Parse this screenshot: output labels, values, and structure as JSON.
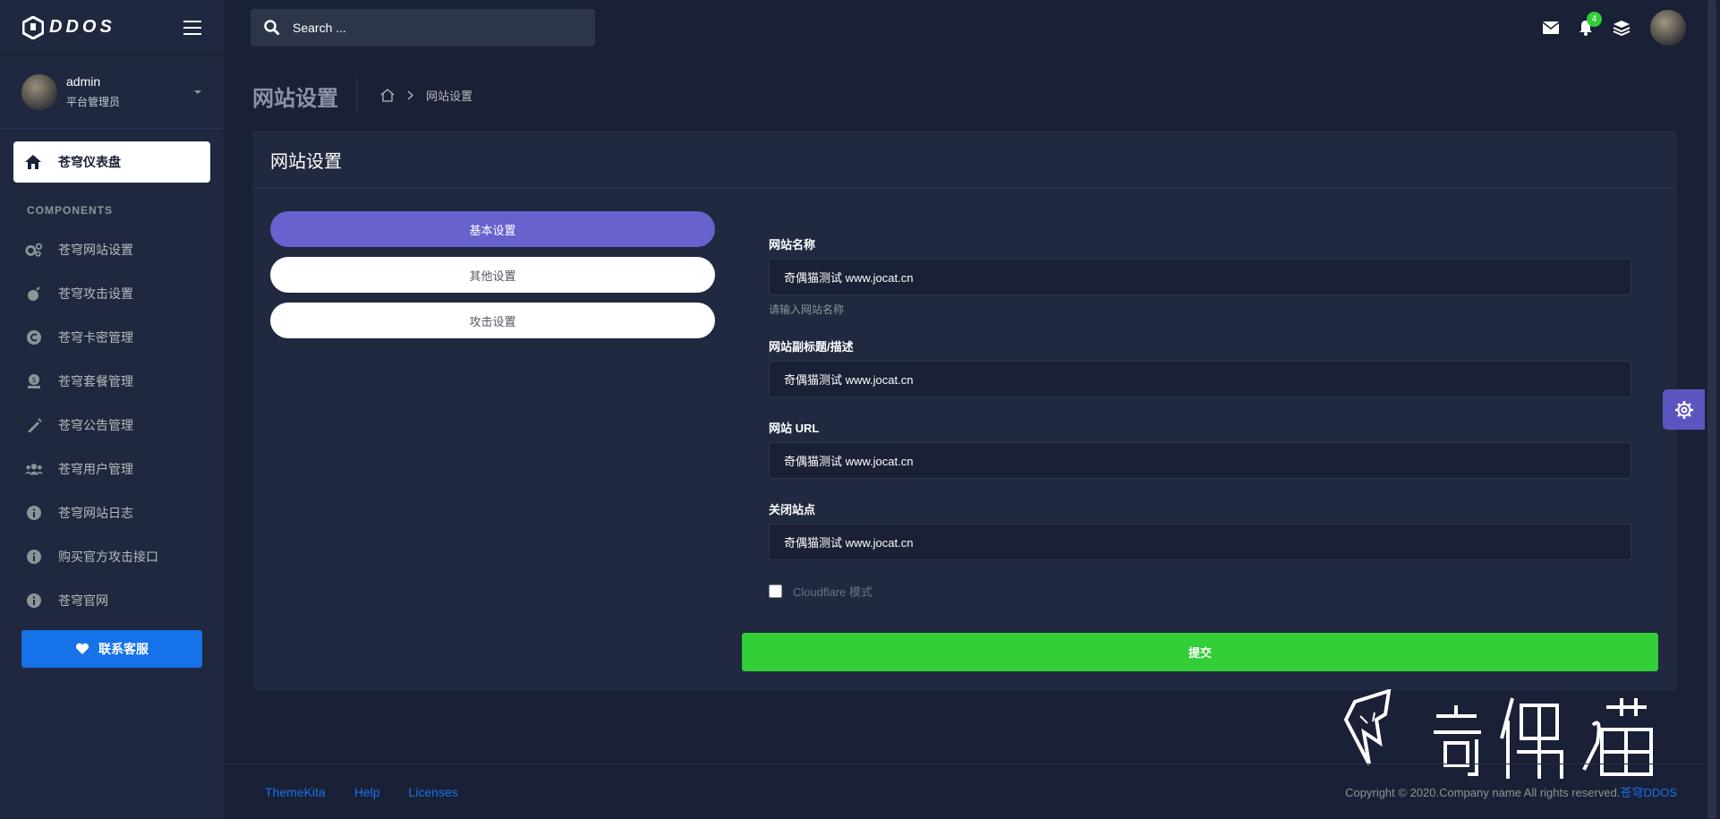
{
  "brand": {
    "logo_text": "DDOS"
  },
  "search": {
    "placeholder": "Search ..."
  },
  "notifications": {
    "count": "4"
  },
  "user": {
    "name": "admin",
    "role": "平台管理员"
  },
  "sidebar": {
    "active_item": "苍穹仪表盘",
    "section_title": "COMPONENTS",
    "items": [
      {
        "label": "苍穹网站设置",
        "icon": "cogs-icon"
      },
      {
        "label": "苍穹攻击设置",
        "icon": "bomb-icon"
      },
      {
        "label": "苍穹卡密管理",
        "icon": "copyright-icon"
      },
      {
        "label": "苍穹套餐管理",
        "icon": "money-bag-icon"
      },
      {
        "label": "苍穹公告管理",
        "icon": "pen-icon"
      },
      {
        "label": "苍穹用户管理",
        "icon": "users-icon"
      },
      {
        "label": "苍穹网站日志",
        "icon": "info-icon"
      },
      {
        "label": "购买官方攻击接口",
        "icon": "info-icon"
      },
      {
        "label": "苍穹官网",
        "icon": "info-icon"
      }
    ],
    "contact_button": "联系客服"
  },
  "page": {
    "title": "网站设置",
    "breadcrumb_current": "网站设置"
  },
  "card": {
    "title": "网站设置",
    "tabs": [
      "基本设置",
      "其他设置",
      "攻击设置"
    ],
    "fields": [
      {
        "label": "网站名称",
        "value": "奇偶猫测试 www.jocat.cn",
        "help": "请输入网站名称"
      },
      {
        "label": "网站副标题/描述",
        "value": "奇偶猫测试 www.jocat.cn"
      },
      {
        "label": "网站 URL",
        "value": "奇偶猫测试 www.jocat.cn"
      },
      {
        "label": "关闭站点",
        "value": "奇偶猫测试 www.jocat.cn"
      }
    ],
    "checkbox_label": "Cloudflare 模式",
    "submit_label": "提交"
  },
  "watermark": {
    "text": "奇偶猫"
  },
  "footer": {
    "links": [
      "ThemeKita",
      "Help",
      "Licenses"
    ],
    "copyright": "Copyright © 2020.Company name All rights reserved.",
    "copyright_brand": "苍穹DDOS"
  },
  "colors": {
    "background": "#1a2035",
    "sidebar": "#1f283e",
    "card": "#202940",
    "accent_purple": "#6861ce",
    "success_green": "#31ce36",
    "primary_blue": "#1572e8"
  }
}
